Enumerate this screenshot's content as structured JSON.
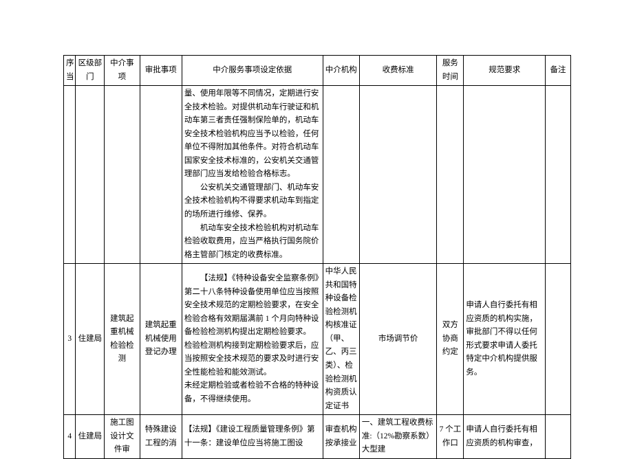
{
  "header": {
    "col1": "序当",
    "col2": "区级部门",
    "col3": "中介事项",
    "col4": "审批事项",
    "col5": "中介服务事项设定依据",
    "col6": "中介机构",
    "col7": "收费标准",
    "col8": "服务时间",
    "col9": "规范要求",
    "col10": "备注"
  },
  "rows": [
    {
      "seq": "",
      "dept": "",
      "svc": "",
      "approval": "",
      "basis_p1": "量、使用年限等不同情况，定期进行安全技术检验。对提供机动车行驶证和机动车第三者责任强制保险单的，机动车安全技术检验机构应当予以检验，任何单位不得附加其他条件。对符合机动车国家安全技术标准的，公安机关交通管理部门应当发给检验合格标志。",
      "basis_p2": "公安机关交通管理部门、机动车安全技术检验机构不得要求机动车到指定的场所进行维修、保养。",
      "basis_p3": "机动车安全技术检验机构对机动车检验收取费用，应当严格执行国务院价格主管部门核定的收费标准。",
      "agency": "",
      "fee": "",
      "time": "",
      "req": "",
      "note": ""
    },
    {
      "seq": "3",
      "dept": "住建局",
      "svc": "建筑起重机械检验检测",
      "approval": "建筑起重机械使用登记办理",
      "basis_p1": "【法规】《特种设备安全监察条例》第二十八条特种设备使用单位应当按照安全技术规范的定期检验要求，在安全检验合格有效期届满前 1 个月向特种设备检验检测机构提出定期检验要求。",
      "basis_p2": "检验检测机构接到定期检验要求后，应当按照安全技术规范的要求及时进行安全性能检验和能效测试。",
      "basis_p3": "未经定期检验或者检验不合格的特种设备，不得继续使用。",
      "agency": "中华人民共和国特种设备检验检测机构核准证（甲、乙、丙三类）、检验检测机构资质认定证书",
      "fee": "市场调节价",
      "time": "双方协商约定",
      "req": "申请人自行委托有相应资质的机构实施，审批部门不得以任何形式要求申请人委托特定中介机构提供服务。",
      "note": ""
    },
    {
      "seq": "4",
      "dept": "住建局",
      "svc": "施工图设计文件审",
      "approval": "特殊建设工程的消",
      "basis_p1": "【法规】《建设工程质量管理条例》第十一条：建设单位应当将施工图设",
      "agency": "审查机构按承接业",
      "fee": "一、建筑工程收费标准:（12%勘察系数）大型建",
      "time": "7 个工作口",
      "req": "申请人自行委托有相应资质的机构审查，",
      "note": ""
    }
  ]
}
